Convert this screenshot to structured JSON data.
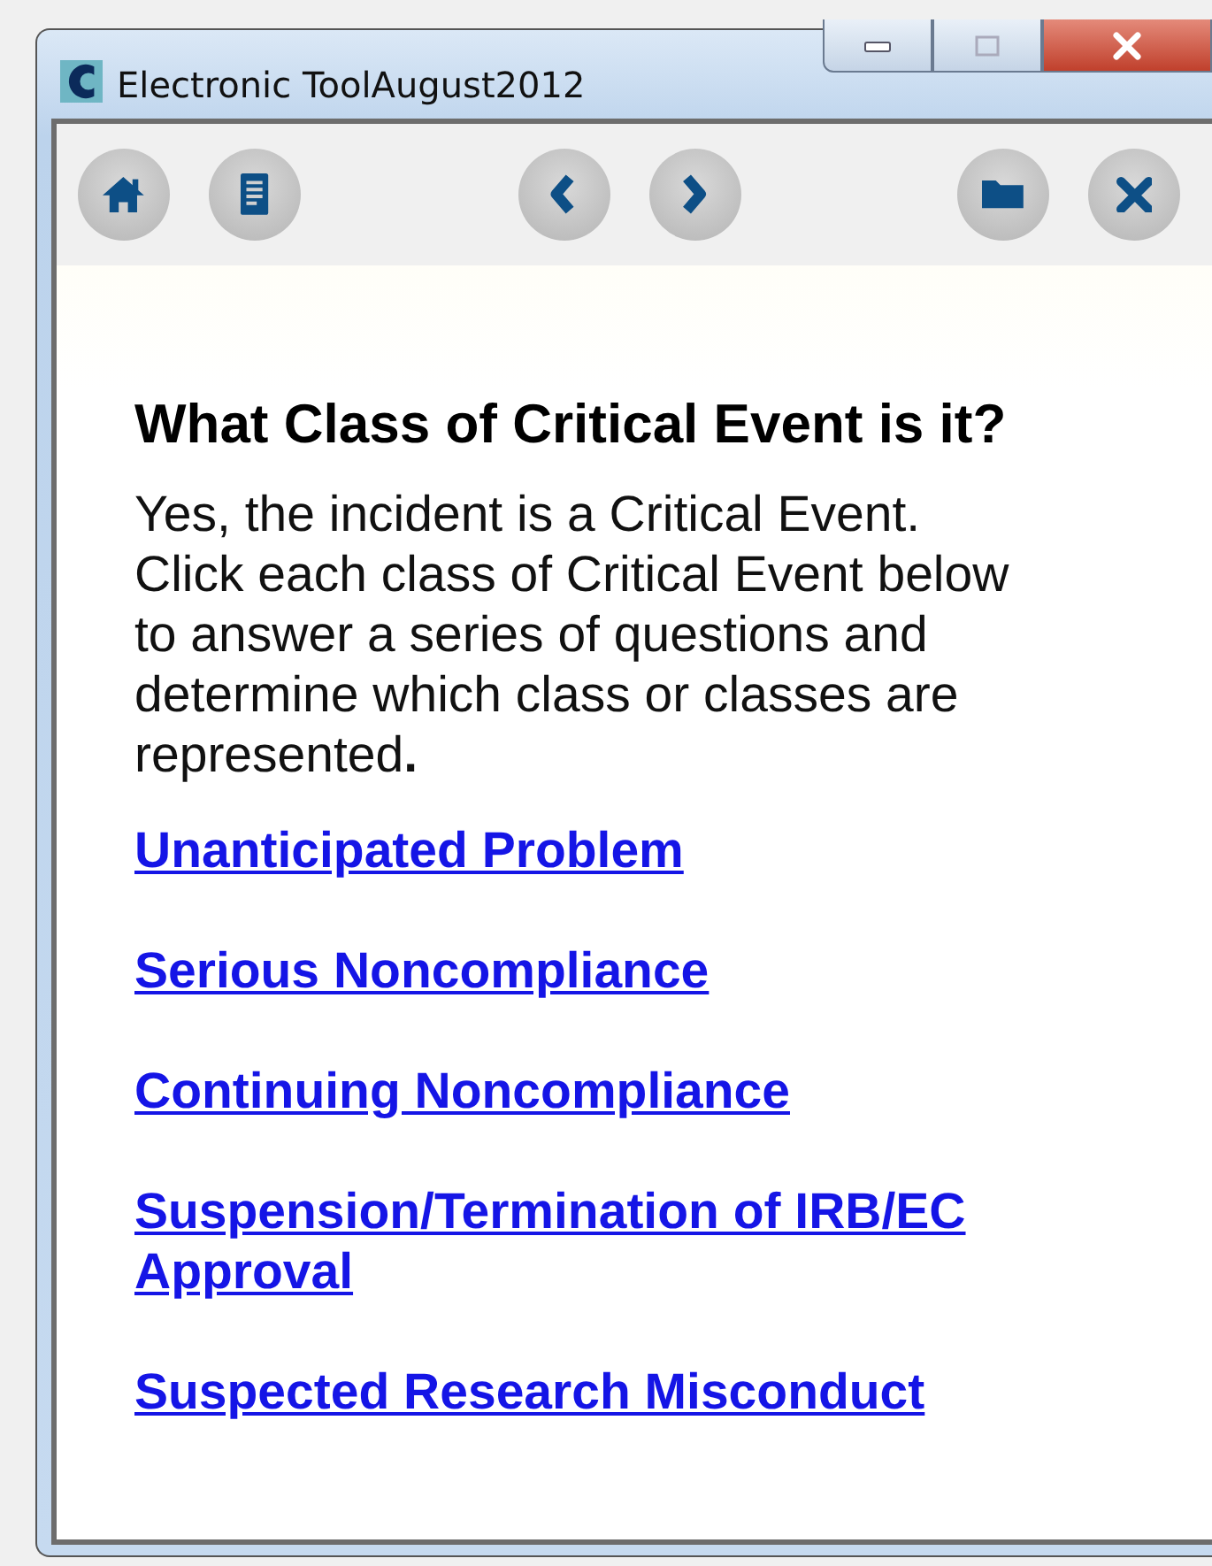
{
  "window": {
    "title": "Electronic ToolAugust2012"
  },
  "toolbar": [
    {
      "kind": "home"
    },
    {
      "kind": "list"
    },
    {
      "kind": "back"
    },
    {
      "kind": "forward"
    },
    {
      "kind": "folder"
    },
    {
      "kind": "close"
    }
  ],
  "content": {
    "heading": "What Class of Critical Event is it?",
    "paragraph": "Yes, the incident is a Critical Event. Click each class of Critical Event below to answer a series of questions and determine which class or classes are represented**.**",
    "links": [
      "Unanticipated Problem",
      "Serious Noncompliance",
      "Continuing Noncompliance",
      "Suspension/Termination of IRB/EC Approval",
      "Suspected Research Misconduct"
    ]
  }
}
